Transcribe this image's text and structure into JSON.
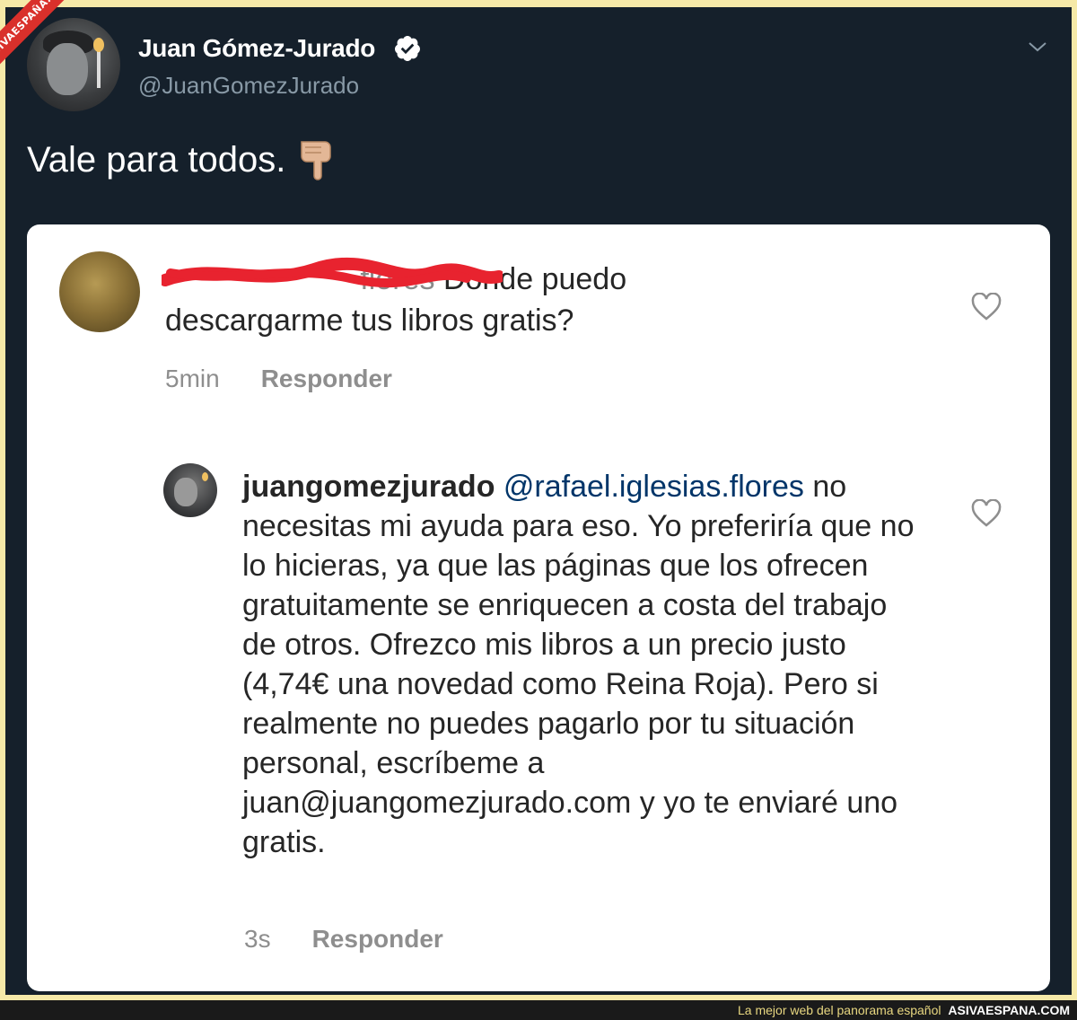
{
  "watermark": {
    "badge": "ASIVAESPAÑA.COM",
    "footer_tagline": "La mejor web del panorama español",
    "footer_site": "ASIVAESPANA.COM"
  },
  "tweet": {
    "author_name": "Juan Gómez-Jurado",
    "handle": "@JuanGomezJurado",
    "text": "Vale para todos.",
    "verified": true
  },
  "screenshot_card": {
    "comment": {
      "username_visible": "flores",
      "text": "Donde puedo descargarme tus libros gratis?",
      "time": "5min",
      "reply_label": "Responder"
    },
    "reply": {
      "username": "juangomezjurado",
      "mention": "@rafael.iglesias.flores",
      "text": "no necesitas mi ayuda para eso. Yo preferiría que no lo hicieras, ya que las páginas que los ofrecen gratuitamente se enriquecen a costa del trabajo de otros. Ofrezco mis libros a un precio  justo (4,74€ una novedad como Reina Roja). Pero si realmente no puedes pagarlo por tu situación personal, escríbeme a juan@juangomezjurado.com y yo te enviaré uno gratis.",
      "time": "3s",
      "reply_label": "Responder"
    }
  },
  "colors": {
    "tweet_bg": "#15202b",
    "frame_bg": "#f5e9a8",
    "mention": "#003569",
    "muted": "#8e8e8e",
    "redaction": "#e8232f"
  }
}
